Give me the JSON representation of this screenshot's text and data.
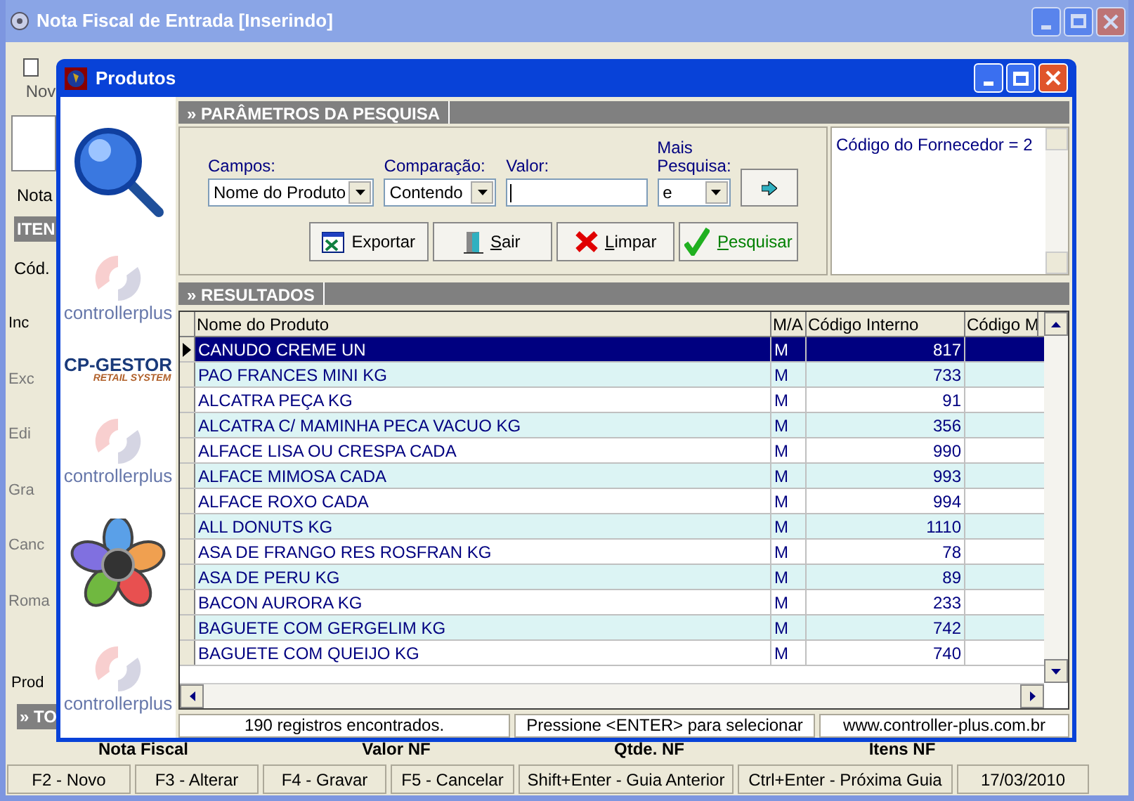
{
  "main_window": {
    "title": "Nota Fiscal de Entrada [Inserindo]",
    "toolbar_label": "Nov",
    "tab": "Nota",
    "section_header": "ITEN",
    "field_label": "Cód.",
    "side_actions": [
      "Inc",
      "Exc",
      "Edi",
      "Gra",
      "Canc",
      "Roma"
    ],
    "bottom_tab": "Prod",
    "totals_header": "» TO",
    "totals_columns": [
      "Nota Fiscal",
      "Valor NF",
      "Qtde. NF",
      "Itens NF"
    ]
  },
  "dialog": {
    "title": "Produtos",
    "logos": [
      {
        "kind": "magnifier"
      },
      {
        "kind": "controllerplus",
        "text": "controllerplus"
      },
      {
        "kind": "gestor",
        "title": "CP-GESTOR",
        "subtitle": "RETAIL SYSTEM"
      },
      {
        "kind": "controllerplus",
        "text": "controllerplus"
      },
      {
        "kind": "flower"
      },
      {
        "kind": "controllerplus",
        "text": "controllerplus"
      }
    ],
    "params": {
      "header": "» PARÂMETROS DA PESQUISA",
      "fields": [
        {
          "kind": "select",
          "label": "Campos:",
          "value": "Nome do Produto"
        },
        {
          "kind": "select",
          "label": "Comparação:",
          "value": "Contendo"
        },
        {
          "kind": "input",
          "label": "Valor:"
        },
        {
          "kind": "select",
          "label": "Mais Pesquisa:",
          "value": "e"
        }
      ],
      "buttons": [
        {
          "kind": "export",
          "label": "Exportar",
          "accel": false
        },
        {
          "kind": "exit",
          "label": "Sair",
          "accel": true
        },
        {
          "kind": "clear",
          "label": "Limpar",
          "accel": true
        },
        {
          "kind": "search",
          "label": "Pesquisar",
          "accel": true
        }
      ],
      "filter_text": "Código do Fornecedor = 2"
    },
    "results": {
      "header": "» RESULTADOS",
      "columns": [
        "Nome do Produto",
        "M/A",
        "Código Interno",
        "Código M"
      ],
      "rows": [
        {
          "name": "CANUDO CREME UN",
          "ma": "M",
          "code": "817",
          "selected": true
        },
        {
          "name": "PAO FRANCES MINI KG",
          "ma": "M",
          "code": "733",
          "selected": false
        },
        {
          "name": "ALCATRA  PEÇA KG",
          "ma": "M",
          "code": "91",
          "selected": false
        },
        {
          "name": "ALCATRA C/ MAMINHA PECA VACUO KG",
          "ma": "M",
          "code": "356",
          "selected": false
        },
        {
          "name": "ALFACE LISA OU CRESPA CADA",
          "ma": "M",
          "code": "990",
          "selected": false
        },
        {
          "name": "ALFACE MIMOSA CADA",
          "ma": "M",
          "code": "993",
          "selected": false
        },
        {
          "name": "ALFACE ROXO CADA",
          "ma": "M",
          "code": "994",
          "selected": false
        },
        {
          "name": "ALL DONUTS KG",
          "ma": "M",
          "code": "1110",
          "selected": false
        },
        {
          "name": "ASA DE FRANGO RES ROSFRAN KG",
          "ma": "M",
          "code": "78",
          "selected": false
        },
        {
          "name": "ASA DE PERU KG",
          "ma": "M",
          "code": "89",
          "selected": false
        },
        {
          "name": "BACON AURORA KG",
          "ma": "M",
          "code": "233",
          "selected": false
        },
        {
          "name": "BAGUETE COM GERGELIM KG",
          "ma": "M",
          "code": "742",
          "selected": false
        },
        {
          "name": "BAGUETE COM QUEIJO KG",
          "ma": "M",
          "code": "740",
          "selected": false
        }
      ]
    },
    "status": [
      "190 registros encontrados.",
      "Pressione <ENTER> para selecionar",
      "www.controller-plus.com.br"
    ]
  },
  "function_keys": [
    "F2 - Novo",
    "F3 - Alterar",
    "F4 - Gravar",
    "F5 - Cancelar",
    "Shift+Enter - Guia Anterior",
    "Ctrl+Enter - Próxima Guia",
    "17/03/2010"
  ]
}
